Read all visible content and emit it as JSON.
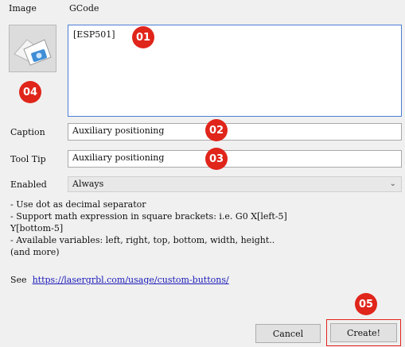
{
  "headers": {
    "image": "Image",
    "gcode": "GCode"
  },
  "gcode": {
    "value": "[ESP501]"
  },
  "caption": {
    "label": "Caption",
    "value": "Auxiliary positioning"
  },
  "tooltip": {
    "label": "Tool Tip",
    "value": "Auxiliary positioning"
  },
  "enabled": {
    "label": "Enabled",
    "selected": "Always"
  },
  "help": {
    "line1": "- Use dot as decimal separator",
    "line2": "- Support math expression in square brackets: i.e. G0 X[left-5]",
    "line3": "Y[bottom-5]",
    "line4": "- Available variables: left, right, top, bottom, width, height..",
    "line5": "(and more)"
  },
  "see": {
    "prefix": "See",
    "url": "https://lasergrbl.com/usage/custom-buttons/"
  },
  "buttons": {
    "cancel": "Cancel",
    "create": "Create!"
  },
  "badges": {
    "b01": "01",
    "b02": "02",
    "b03": "03",
    "b04": "04",
    "b05": "05"
  },
  "colors": {
    "badge": "#e0251b",
    "link": "#1a1ab8",
    "focus_border": "#4a7fd4"
  },
  "icons": {
    "image_button": "image-icon",
    "dropdown": "chevron-down-icon"
  }
}
